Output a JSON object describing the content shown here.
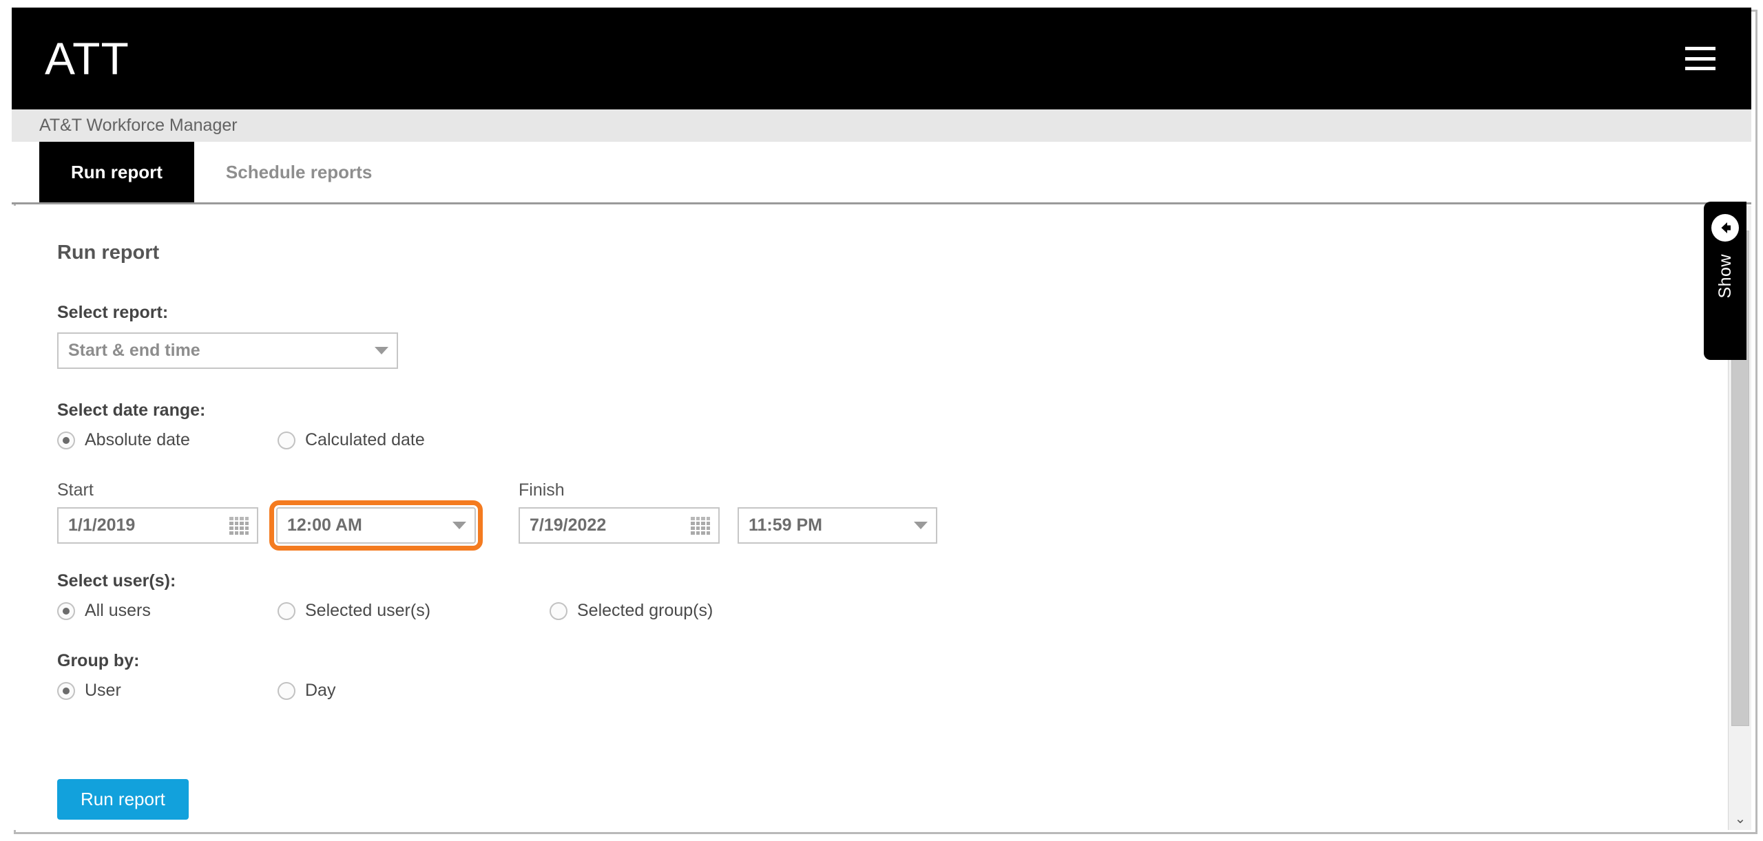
{
  "header": {
    "brand": "ATT",
    "menu_icon": "hamburger-menu-icon"
  },
  "app_strip": {
    "title": "AT&T Workforce Manager"
  },
  "tabs": [
    {
      "label": "Run report",
      "active": true
    },
    {
      "label": "Schedule reports",
      "active": false
    }
  ],
  "main": {
    "heading": "Run report",
    "select_report": {
      "label": "Select report:",
      "value": "Start & end time"
    },
    "date_range": {
      "label": "Select date range:",
      "options": [
        {
          "label": "Absolute date",
          "selected": true
        },
        {
          "label": "Calculated date",
          "selected": false
        }
      ]
    },
    "start": {
      "label": "Start",
      "date": "1/1/2019",
      "time": "12:00 AM",
      "time_highlighted": true
    },
    "finish": {
      "label": "Finish",
      "date": "7/19/2022",
      "time": "11:59 PM",
      "time_highlighted": false
    },
    "select_users": {
      "label": "Select user(s):",
      "options": [
        {
          "label": "All users",
          "selected": true
        },
        {
          "label": "Selected user(s)",
          "selected": false
        },
        {
          "label": "Selected group(s)",
          "selected": false
        }
      ]
    },
    "group_by": {
      "label": "Group by:",
      "options": [
        {
          "label": "User",
          "selected": true
        },
        {
          "label": "Day",
          "selected": false
        }
      ]
    },
    "run_button": "Run report"
  },
  "side_panel": {
    "label": "Show",
    "icon": "arrow-left-circle-icon"
  },
  "scrollbar": {
    "up_arrow": "⌃",
    "down_arrow": "⌄"
  },
  "colors": {
    "highlight": "#f47b20",
    "primary_button": "#12a1dc",
    "header_bg": "#000000"
  }
}
